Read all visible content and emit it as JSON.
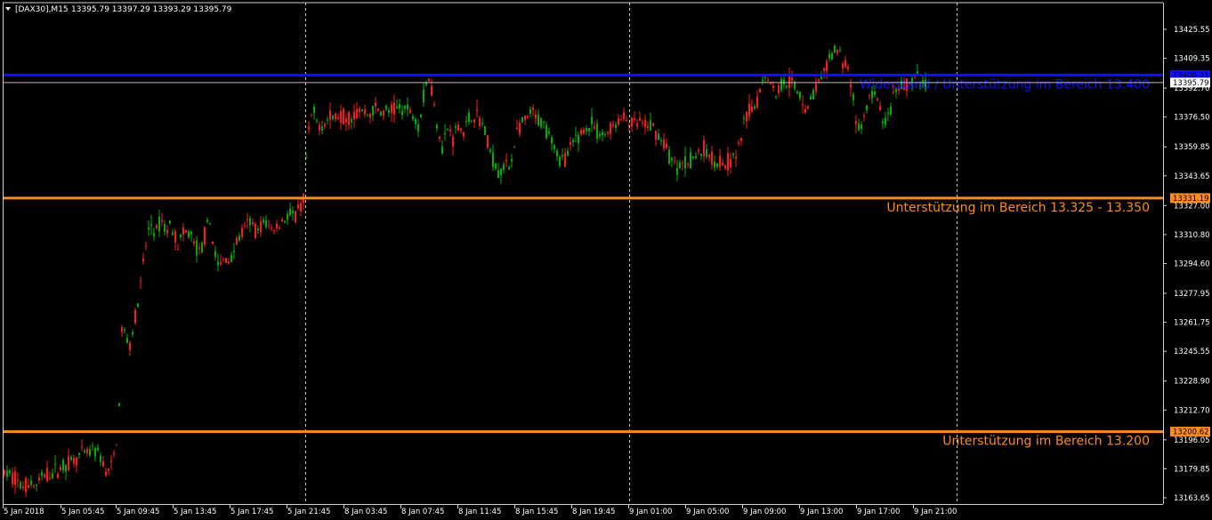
{
  "header": {
    "symbol_label": "[DAX30],M15",
    "ohlc_label": "13395.79 13397.29 13393.29 13395.79"
  },
  "chart_data": {
    "type": "candlestick",
    "title": "[DAX30],M15",
    "symbol": "DAX30",
    "timeframe": "M15",
    "ylim": [
      13163.65,
      13433.0
    ],
    "y_ticks": [
      "13425.55",
      "13409.35",
      "13392.70",
      "13376.50",
      "13359.85",
      "13343.65",
      "13327.00",
      "13310.80",
      "13294.60",
      "13277.95",
      "13261.75",
      "13245.55",
      "13228.90",
      "13212.70",
      "13196.05",
      "13179.85",
      "13163.65"
    ],
    "x_ticks": [
      "5 Jan 2018",
      "5 Jan 05:45",
      "5 Jan 09:45",
      "5 Jan 13:45",
      "5 Jan 17:45",
      "5 Jan 21:45",
      "8 Jan 03:45",
      "8 Jan 07:45",
      "8 Jan 11:45",
      "8 Jan 15:45",
      "8 Jan 19:45",
      "9 Jan 01:00",
      "9 Jan 05:00",
      "9 Jan 09:00",
      "9 Jan 13:00",
      "9 Jan 17:00",
      "9 Jan 21:00"
    ],
    "session_separators": [
      "5 Jan 21:45",
      "9 Jan 01:00",
      "9 Jan 21:00"
    ],
    "grid": false,
    "bull_color": "#00b000",
    "bear_color": "#ff1a1a",
    "current_price": 13395.79,
    "current_price_label": "13395.79",
    "horizontal_levels": [
      {
        "value": 13400.0,
        "price_label": "13400.31",
        "text": "Widerstand / Unterstützung im Bereich 13.400",
        "color": "#1010ff"
      },
      {
        "value": 13331.19,
        "price_label": "13331.19",
        "text": "Unterstützung im Bereich 13.325 - 13.350",
        "color": "#ff8c1a"
      },
      {
        "value": 13200.62,
        "price_label": "13200.62",
        "text": "Unterstützung im Bereich 13.200",
        "color": "#ff8c1a"
      }
    ],
    "price_path": [
      [
        0,
        13178
      ],
      [
        16,
        13175
      ],
      [
        22,
        13170
      ],
      [
        34,
        13172
      ],
      [
        40,
        13170
      ],
      [
        48,
        13176
      ],
      [
        60,
        13178
      ],
      [
        72,
        13182
      ],
      [
        84,
        13186
      ],
      [
        96,
        13188
      ],
      [
        106,
        13190
      ],
      [
        112,
        13186
      ],
      [
        118,
        13178
      ],
      [
        124,
        13180
      ],
      [
        128,
        13190
      ],
      [
        132,
        13200
      ],
      [
        136,
        13258
      ],
      [
        140,
        13255
      ],
      [
        144,
        13248
      ],
      [
        150,
        13262
      ],
      [
        156,
        13278
      ],
      [
        162,
        13302
      ],
      [
        168,
        13318
      ],
      [
        174,
        13310
      ],
      [
        180,
        13320
      ],
      [
        186,
        13312
      ],
      [
        192,
        13318
      ],
      [
        198,
        13305
      ],
      [
        204,
        13310
      ],
      [
        212,
        13312
      ],
      [
        218,
        13305
      ],
      [
        224,
        13300
      ],
      [
        230,
        13312
      ],
      [
        236,
        13318
      ],
      [
        240,
        13300
      ],
      [
        246,
        13292
      ],
      [
        252,
        13298
      ],
      [
        258,
        13296
      ],
      [
        264,
        13306
      ],
      [
        272,
        13312
      ],
      [
        280,
        13318
      ],
      [
        288,
        13312
      ],
      [
        296,
        13318
      ],
      [
        304,
        13314
      ],
      [
        312,
        13316
      ],
      [
        318,
        13320
      ],
      [
        324,
        13322
      ],
      [
        330,
        13320
      ],
      [
        336,
        13325
      ],
      [
        340,
        13330
      ],
      [
        344,
        13360
      ],
      [
        350,
        13380
      ],
      [
        356,
        13372
      ],
      [
        364,
        13374
      ],
      [
        372,
        13376
      ],
      [
        380,
        13378
      ],
      [
        388,
        13376
      ],
      [
        396,
        13378
      ],
      [
        404,
        13380
      ],
      [
        412,
        13378
      ],
      [
        420,
        13381
      ],
      [
        430,
        13379
      ],
      [
        440,
        13380
      ],
      [
        450,
        13382
      ],
      [
        458,
        13380
      ],
      [
        464,
        13378
      ],
      [
        470,
        13372
      ],
      [
        474,
        13385
      ],
      [
        478,
        13395
      ],
      [
        482,
        13400
      ],
      [
        486,
        13385
      ],
      [
        490,
        13375
      ],
      [
        496,
        13360
      ],
      [
        502,
        13370
      ],
      [
        508,
        13365
      ],
      [
        514,
        13372
      ],
      [
        520,
        13368
      ],
      [
        526,
        13375
      ],
      [
        532,
        13378
      ],
      [
        538,
        13375
      ],
      [
        542,
        13372
      ],
      [
        548,
        13360
      ],
      [
        554,
        13352
      ],
      [
        560,
        13345
      ],
      [
        566,
        13350
      ],
      [
        572,
        13348
      ],
      [
        576,
        13360
      ],
      [
        580,
        13368
      ],
      [
        586,
        13372
      ],
      [
        592,
        13375
      ],
      [
        596,
        13380
      ],
      [
        600,
        13376
      ],
      [
        606,
        13374
      ],
      [
        612,
        13370
      ],
      [
        618,
        13368
      ],
      [
        622,
        13360
      ],
      [
        628,
        13352
      ],
      [
        634,
        13354
      ],
      [
        640,
        13358
      ],
      [
        646,
        13364
      ],
      [
        652,
        13368
      ],
      [
        658,
        13370
      ],
      [
        664,
        13372
      ],
      [
        670,
        13368
      ],
      [
        676,
        13366
      ],
      [
        682,
        13368
      ],
      [
        688,
        13372
      ],
      [
        694,
        13374
      ],
      [
        700,
        13376
      ],
      [
        706,
        13374
      ],
      [
        712,
        13372
      ],
      [
        718,
        13374
      ],
      [
        724,
        13370
      ],
      [
        730,
        13372
      ],
      [
        736,
        13368
      ],
      [
        742,
        13365
      ],
      [
        748,
        13358
      ],
      [
        754,
        13352
      ],
      [
        760,
        13348
      ],
      [
        766,
        13350
      ],
      [
        772,
        13352
      ],
      [
        778,
        13354
      ],
      [
        784,
        13356
      ],
      [
        790,
        13358
      ],
      [
        796,
        13355
      ],
      [
        802,
        13353
      ],
      [
        808,
        13352
      ],
      [
        814,
        13350
      ],
      [
        820,
        13352
      ],
      [
        828,
        13356
      ],
      [
        834,
        13370
      ],
      [
        840,
        13380
      ],
      [
        846,
        13382
      ],
      [
        852,
        13388
      ],
      [
        856,
        13398
      ],
      [
        860,
        13402
      ],
      [
        866,
        13394
      ],
      [
        872,
        13390
      ],
      [
        878,
        13396
      ],
      [
        884,
        13398
      ],
      [
        890,
        13394
      ],
      [
        896,
        13390
      ],
      [
        900,
        13388
      ],
      [
        906,
        13380
      ],
      [
        910,
        13386
      ],
      [
        914,
        13392
      ],
      [
        920,
        13396
      ],
      [
        926,
        13400
      ],
      [
        930,
        13408
      ],
      [
        934,
        13410
      ],
      [
        938,
        13416
      ],
      [
        942,
        13412
      ],
      [
        946,
        13408
      ],
      [
        950,
        13405
      ],
      [
        954,
        13400
      ],
      [
        958,
        13386
      ],
      [
        962,
        13372
      ],
      [
        966,
        13368
      ],
      [
        970,
        13376
      ],
      [
        974,
        13384
      ],
      [
        980,
        13390
      ],
      [
        986,
        13384
      ],
      [
        990,
        13378
      ],
      [
        994,
        13372
      ],
      [
        998,
        13376
      ],
      [
        1004,
        13388
      ],
      [
        1010,
        13392
      ],
      [
        1016,
        13394
      ],
      [
        1022,
        13396
      ],
      [
        1028,
        13398
      ],
      [
        1034,
        13396
      ],
      [
        1040,
        13395.79
      ]
    ]
  }
}
